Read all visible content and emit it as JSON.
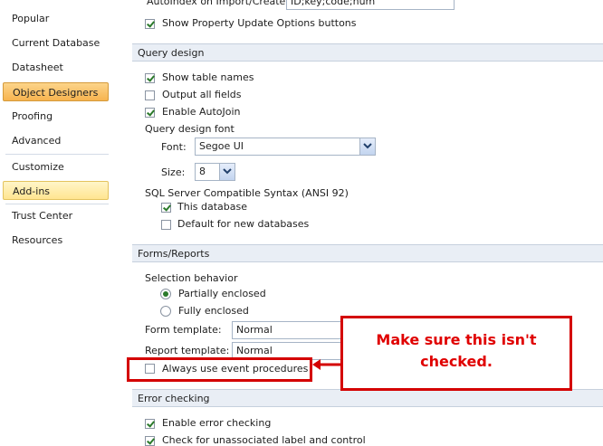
{
  "nav": {
    "items": [
      {
        "label": "Popular"
      },
      {
        "label": "Current Database"
      },
      {
        "label": "Datasheet"
      },
      {
        "label": "Object Designers"
      },
      {
        "label": "Proofing"
      },
      {
        "label": "Advanced"
      },
      {
        "label": "Customize"
      },
      {
        "label": "Add-ins"
      },
      {
        "label": "Trust Center"
      },
      {
        "label": "Resources"
      }
    ],
    "selected": "Object Designers",
    "hover": "Add-ins"
  },
  "top_partial": {
    "autoindex_label": "AutoIndex on Import/Create:",
    "autoindex_value": "ID;key;code;num",
    "show_property_update_label": "Show Property Update Options buttons",
    "show_property_update_checked": true
  },
  "query_design": {
    "header": "Query design",
    "show_table_names_label": "Show table names",
    "show_table_names_checked": true,
    "output_all_fields_label": "Output all fields",
    "output_all_fields_checked": false,
    "enable_autojoin_label": "Enable AutoJoin",
    "enable_autojoin_checked": true,
    "font_group_label": "Query design font",
    "font_label": "Font:",
    "font_value": "Segoe UI",
    "size_label": "Size:",
    "size_value": "8",
    "sql_syntax_label": "SQL Server Compatible Syntax (ANSI 92)",
    "this_database_label": "This database",
    "this_database_checked": true,
    "default_new_db_label": "Default for new databases",
    "default_new_db_checked": false
  },
  "forms_reports": {
    "header": "Forms/Reports",
    "selection_behavior_label": "Selection behavior",
    "partially_enclosed_label": "Partially enclosed",
    "partially_enclosed_selected": true,
    "fully_enclosed_label": "Fully enclosed",
    "fully_enclosed_selected": false,
    "form_template_label": "Form template:",
    "form_template_value": "Normal",
    "report_template_label": "Report template:",
    "report_template_value": "Normal",
    "always_use_event_label": "Always use event procedures",
    "always_use_event_checked": false
  },
  "error_checking": {
    "header": "Error checking",
    "enable_error_checking_label": "Enable error checking",
    "enable_error_checking_checked": true,
    "check_unassociated_label": "Check for unassociated label and control",
    "check_unassociated_checked": true
  },
  "annotation": {
    "text": "Make sure this isn't checked.",
    "color": "#d40000"
  },
  "colors": {
    "selected_nav": "#f7b44f",
    "hover_nav": "#ffe591",
    "section_bg": "#e9eef5",
    "check_mark": "#2b7a2b"
  }
}
